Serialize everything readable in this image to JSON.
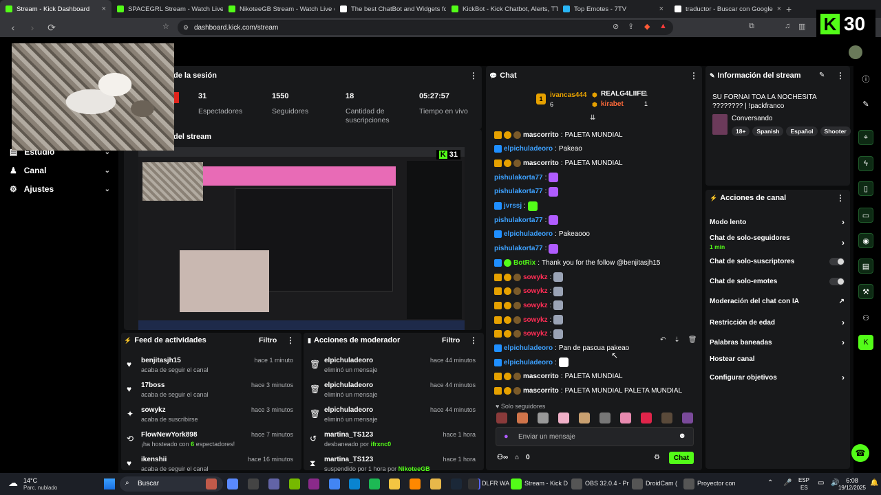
{
  "browser": {
    "tabs": [
      {
        "title": "Stream - Kick Dashboard",
        "active": true,
        "color": "#53fc18"
      },
      {
        "title": "SPACEGRL Stream - Watch Live on Ki",
        "color": "#53fc18"
      },
      {
        "title": "NikoteeGB Stream - Watch Live on Ki",
        "color": "#53fc18"
      },
      {
        "title": "The best ChatBot and Widgets for Ki",
        "color": "#ffffff"
      },
      {
        "title": "KickBot - Kick Chatbot, Alerts, TTS, C",
        "color": "#53fc18"
      },
      {
        "title": "Top Emotes - 7TV",
        "color": "#29b6f6"
      },
      {
        "title": "traductor - Buscar con Google",
        "color": "#ffffff"
      }
    ],
    "url": "dashboard.kick.com/stream"
  },
  "overlay": {
    "kick_count": "30"
  },
  "leftnav": [
    {
      "label": "Estudio",
      "icon": "studio-icon"
    },
    {
      "label": "Canal",
      "icon": "channel-icon"
    },
    {
      "label": "Ajustes",
      "icon": "settings-icon"
    }
  ],
  "session": {
    "title": "de la sesión",
    "stats": [
      {
        "value": "31",
        "label": "Espectadores"
      },
      {
        "value": "1550",
        "label": "Seguidores"
      },
      {
        "value": "18",
        "label": "Cantidad de suscripciones"
      },
      {
        "value": "05:27:57",
        "label": "Tiempo en vivo"
      }
    ]
  },
  "preview": {
    "title": "del stream",
    "count": "31"
  },
  "feed": {
    "title": "Feed de actividades",
    "filter": "Filtro",
    "items": [
      {
        "name": "benjitasjh15",
        "time": "hace 1 minuto",
        "desc": "acaba de seguir el canal",
        "icon": "heart-icon"
      },
      {
        "name": "17boss",
        "time": "hace 3 minutos",
        "desc": "acaba de seguir el canal",
        "icon": "heart-icon"
      },
      {
        "name": "sowykz",
        "time": "hace 3 minutos",
        "desc": "acaba de suscribirse",
        "icon": "star-icon"
      },
      {
        "name": "FlowNewYork898",
        "time": "hace 7 minutos",
        "desc_pre": "¡ha hosteado con ",
        "desc_num": "6",
        "desc_post": " espectadores!",
        "icon": "host-icon"
      },
      {
        "name": "ikenshii",
        "time": "hace 16 minutos",
        "desc": "acaba de seguir el canal",
        "icon": "heart-icon"
      }
    ]
  },
  "mod": {
    "title": "Acciones de moderador",
    "filter": "Filtro",
    "items": [
      {
        "name": "elpichuladeoro",
        "time": "hace 44 minutos",
        "desc": "eliminó un mensaje",
        "icon": "trash-icon"
      },
      {
        "name": "elpichuladeoro",
        "time": "hace 44 minutos",
        "desc": "eliminó un mensaje",
        "icon": "trash-icon"
      },
      {
        "name": "elpichuladeoro",
        "time": "hace 44 minutos",
        "desc": "eliminó un mensaje",
        "icon": "trash-icon"
      },
      {
        "name": "martina_TS123",
        "time": "hace 1 hora",
        "desc_pre": "desbaneado por ",
        "desc_user": "ifrxnc0",
        "icon": "unban-icon"
      },
      {
        "name": "martina_TS123",
        "time": "hace 1 hora",
        "desc_pre": "suspendido por 1 hora por ",
        "desc_user": "NikoteeGB",
        "icon": "timeout-icon"
      }
    ]
  },
  "chat": {
    "title": "Chat",
    "leaders": [
      {
        "name": "ivancas444",
        "count": "6"
      },
      {
        "name": "REALG4LIIFE",
        "count": "1"
      },
      {
        "name": "kirabet",
        "count": "1"
      }
    ],
    "messages": [
      {
        "badges": [
          "crown",
          "one",
          "sub"
        ],
        "user": "mascorrito",
        "color": "#ffffff",
        "text": "PALETA MUNDIAL"
      },
      {
        "badges": [
          "mod"
        ],
        "user": "elpichuladeoro",
        "color": "#3da1ff",
        "text": "Pakeao"
      },
      {
        "badges": [
          "crown",
          "one",
          "sub"
        ],
        "user": "mascorrito",
        "color": "#ffffff",
        "text": "PALETA MUNDIAL"
      },
      {
        "badges": [],
        "user": "pishulakorta77",
        "color": "#3da1ff",
        "text": "",
        "emote": "#b05cff"
      },
      {
        "badges": [],
        "user": "pishulakorta77",
        "color": "#3da1ff",
        "text": "",
        "emote": "#b05cff"
      },
      {
        "badges": [
          "mod"
        ],
        "user": "jvrssj",
        "color": "#3da1ff",
        "text": "",
        "emote": "#53fc18"
      },
      {
        "badges": [],
        "user": "pishulakorta77",
        "color": "#3da1ff",
        "text": "",
        "emote": "#b05cff"
      },
      {
        "badges": [
          "mod"
        ],
        "user": "elpichuladeoro",
        "color": "#3da1ff",
        "text": "Pakeaooo"
      },
      {
        "badges": [],
        "user": "pishulakorta77",
        "color": "#3da1ff",
        "text": "",
        "emote": "#b05cff"
      },
      {
        "badges": [
          "mod",
          "bot"
        ],
        "user": "BotRix",
        "color": "#53fc18",
        "text": "Thank you for the follow @benjitasjh15"
      },
      {
        "badges": [
          "crown",
          "one",
          "sub"
        ],
        "user": "sowykz",
        "color": "#ff2d55",
        "text": "",
        "emote": "#9aa3b5"
      },
      {
        "badges": [
          "crown",
          "one",
          "sub"
        ],
        "user": "sowykz",
        "color": "#ff2d55",
        "text": "",
        "emote": "#9aa3b5"
      },
      {
        "badges": [
          "crown",
          "one",
          "sub"
        ],
        "user": "sowykz",
        "color": "#ff2d55",
        "text": "",
        "emote": "#9aa3b5"
      },
      {
        "badges": [
          "crown",
          "one",
          "sub"
        ],
        "user": "sowykz",
        "color": "#ff2d55",
        "text": "",
        "emote": "#9aa3b5"
      },
      {
        "badges": [
          "crown",
          "one",
          "sub"
        ],
        "user": "sowykz",
        "color": "#ff2d55",
        "text": "",
        "emote": "#9aa3b5"
      },
      {
        "badges": [
          "mod"
        ],
        "user": "elpichuladeoro",
        "color": "#3da1ff",
        "text": "Pan de pascua pakeao"
      },
      {
        "badges": [
          "mod"
        ],
        "user": "elpichuladeoro",
        "color": "#3da1ff",
        "text": "",
        "emote": "#ffffff"
      },
      {
        "badges": [
          "crown",
          "one",
          "sub"
        ],
        "user": "mascorrito",
        "color": "#ffffff",
        "text": "PALETA MUNDIAL"
      },
      {
        "badges": [
          "crown",
          "one",
          "sub"
        ],
        "user": "mascorrito",
        "color": "#ffffff",
        "text": "PALETA MUNDIAL PALETA MUNDIAL"
      }
    ],
    "followers_only": "Solo seguidores",
    "input_placeholder": "Enviar un mensaje",
    "points": "0",
    "send": "Chat"
  },
  "streaminfo": {
    "title": "Información del stream",
    "stream_title": "SU FORNAI TOA LA NOCHESITA ???????? | !packfranco",
    "category": "Conversando",
    "tags": [
      "18+",
      "Spanish",
      "Español",
      "Shooter"
    ]
  },
  "actions": {
    "title": "Acciones de canal",
    "items": [
      {
        "label": "Modo lento",
        "type": "chevron"
      },
      {
        "label": "Chat de solo-seguidores",
        "sub": "1 min",
        "type": "chevron"
      },
      {
        "label": "Chat de solo-suscriptores",
        "type": "toggle"
      },
      {
        "label": "Chat de solo-emotes",
        "type": "toggle"
      },
      {
        "label": "Moderación del chat con IA",
        "type": "external"
      },
      {
        "label": "Restricción de edad",
        "type": "chevron"
      },
      {
        "label": "Palabras baneadas",
        "type": "chevron"
      },
      {
        "label": "Hostear canal",
        "type": "none"
      },
      {
        "label": "Configurar objetivos",
        "type": "chevron"
      }
    ]
  },
  "taskbar": {
    "weather_temp": "14°C",
    "weather_desc": "Parc. nublado",
    "search": "Buscar",
    "apps": [
      "DLFR WA",
      "Stream - Kick D",
      "OBS 32.0.4 - Pr",
      "DroidCam (",
      "Proyector con"
    ],
    "lang": "ESP",
    "lang2": "ES",
    "time": "6:08",
    "date": "19/12/2025"
  }
}
